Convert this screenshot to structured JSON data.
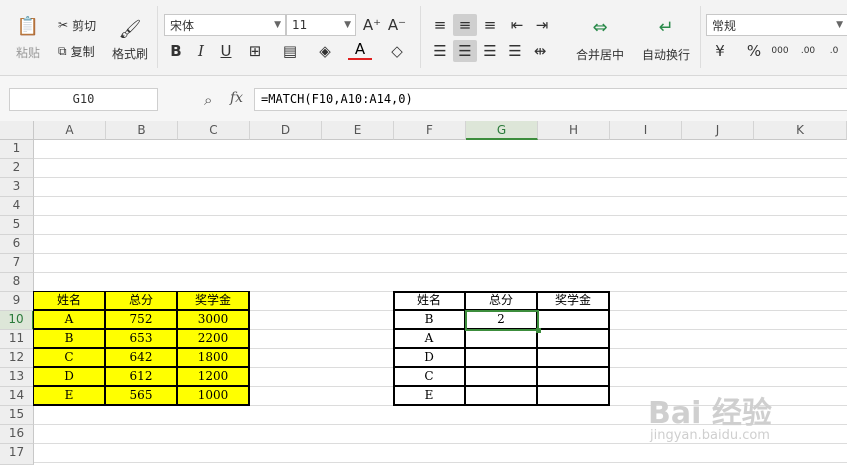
{
  "ribbon": {
    "paste": "粘贴",
    "cut": "剪切",
    "copy": "复制",
    "format_painter": "格式刷",
    "font_name": "宋体",
    "font_size": "11",
    "merge_center": "合并居中",
    "wrap_text": "自动换行",
    "number_format": "常规"
  },
  "formula_bar": {
    "name_box": "G10",
    "fx": "fx",
    "formula": "=MATCH(F10,A10:A14,0)"
  },
  "columns": [
    "A",
    "B",
    "C",
    "D",
    "E",
    "F",
    "G",
    "H",
    "I",
    "J",
    "K"
  ],
  "rows": [
    "1",
    "2",
    "3",
    "4",
    "5",
    "6",
    "7",
    "8",
    "9",
    "10",
    "11",
    "12",
    "13",
    "14",
    "15",
    "16",
    "17"
  ],
  "left_table": {
    "headers": [
      "姓名",
      "总分",
      "奖学金"
    ],
    "rows": [
      [
        "A",
        "752",
        "3000"
      ],
      [
        "B",
        "653",
        "2200"
      ],
      [
        "C",
        "642",
        "1800"
      ],
      [
        "D",
        "612",
        "1200"
      ],
      [
        "E",
        "565",
        "1000"
      ]
    ]
  },
  "right_table": {
    "headers": [
      "姓名",
      "总分",
      "奖学金"
    ],
    "rows": [
      [
        "B",
        "2",
        ""
      ],
      [
        "A",
        "",
        ""
      ],
      [
        "D",
        "",
        ""
      ],
      [
        "C",
        "",
        ""
      ],
      [
        "E",
        "",
        ""
      ]
    ]
  },
  "watermark": {
    "brand": "Bai 经验",
    "url": "jingyan.baidu.com"
  },
  "colors": {
    "yellow_fill": "#ffff00",
    "selection_green": "#3c8d3c",
    "font_color_red": "#e02020"
  }
}
